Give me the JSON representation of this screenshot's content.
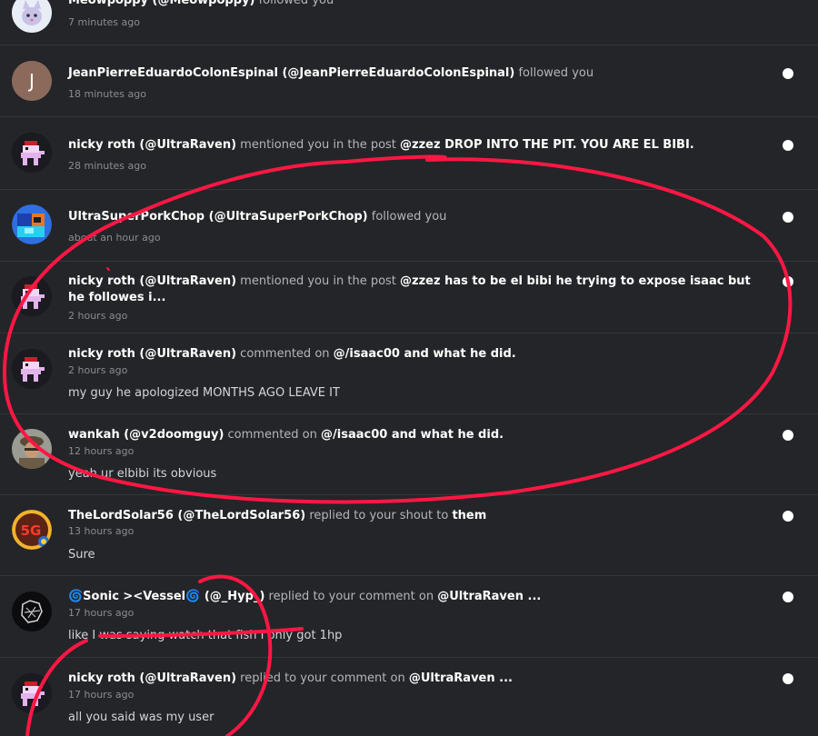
{
  "notifications": [
    {
      "actor": "Meowpoppy (@Meowpoppy)",
      "action": "followed you",
      "target": "",
      "time": "7 minutes ago",
      "preview": "",
      "unread": false,
      "avatar": "kitten-avatar-icon"
    },
    {
      "actor": "JeanPierreEduardoColonEspinal (@JeanPierreEduardoColonEspinal)",
      "action": "followed you",
      "target": "",
      "time": "18 minutes ago",
      "preview": "",
      "unread": true,
      "avatar": "letter-j-avatar-icon",
      "avatar_letter": "J"
    },
    {
      "actor": "nicky roth (@UltraRaven)",
      "action": "mentioned you in the post",
      "target": "@zzez  DROP INTO THE PIT. YOU ARE EL BIBI.",
      "time": "28 minutes ago",
      "preview": "",
      "unread": true,
      "avatar": "pixel-raven-avatar-icon"
    },
    {
      "actor": "UltraSuperPorkChop (@UltraSuperPorkChop)",
      "action": "followed you",
      "target": "",
      "time": "about an hour ago",
      "preview": "",
      "unread": true,
      "avatar": "pixel-block-avatar-icon"
    },
    {
      "actor": "nicky roth (@UltraRaven)",
      "action": "mentioned you in the post",
      "target": "@zzez has to be el bibi he trying to expose isaac but he followes i...",
      "time": "2 hours ago",
      "preview": "",
      "unread": true,
      "avatar": "pixel-raven-avatar-icon"
    },
    {
      "actor": "nicky roth (@UltraRaven)",
      "action": "commented on",
      "target": "@/isaac00 and what he did.",
      "time": "2 hours ago",
      "preview": "my guy he apologized MONTHS AGO LEAVE IT",
      "unread": false,
      "avatar": "pixel-raven-avatar-icon"
    },
    {
      "actor": "wankah (@v2doomguy)",
      "action": "commented on",
      "target": "@/isaac00 and what he did.",
      "time": "12 hours ago",
      "preview": "yeah ur elbibi its obvious",
      "unread": true,
      "avatar": "soldier-avatar-icon"
    },
    {
      "actor": "TheLordSolar56 (@TheLordSolar56)",
      "action": "replied to your shout to",
      "target": "them",
      "time": "13 hours ago",
      "preview": "Sure",
      "unread": true,
      "avatar": "sg-badge-avatar-icon"
    },
    {
      "actor": "🌀Sonic ><Vessel🌀 (@_Hyp_)",
      "action": "replied to your comment on",
      "target": "@UltraRaven ...",
      "time": "17 hours ago",
      "preview": "like I was saying watch that fish I only got 1hp",
      "unread": true,
      "avatar": "sketch-avatar-icon"
    },
    {
      "actor": "nicky roth (@UltraRaven)",
      "action": "replied to your comment on",
      "target": "@UltraRaven ...",
      "time": "17 hours ago",
      "preview": "all you said was my user",
      "unread": true,
      "avatar": "pixel-raven-avatar-icon"
    }
  ],
  "colors": {
    "background": "#242528",
    "divider": "#34363a",
    "text_bold": "#ffffff",
    "text_muted": "#8a8c91",
    "unread_dot": "#ffffff",
    "scribble": "#ff1744"
  }
}
